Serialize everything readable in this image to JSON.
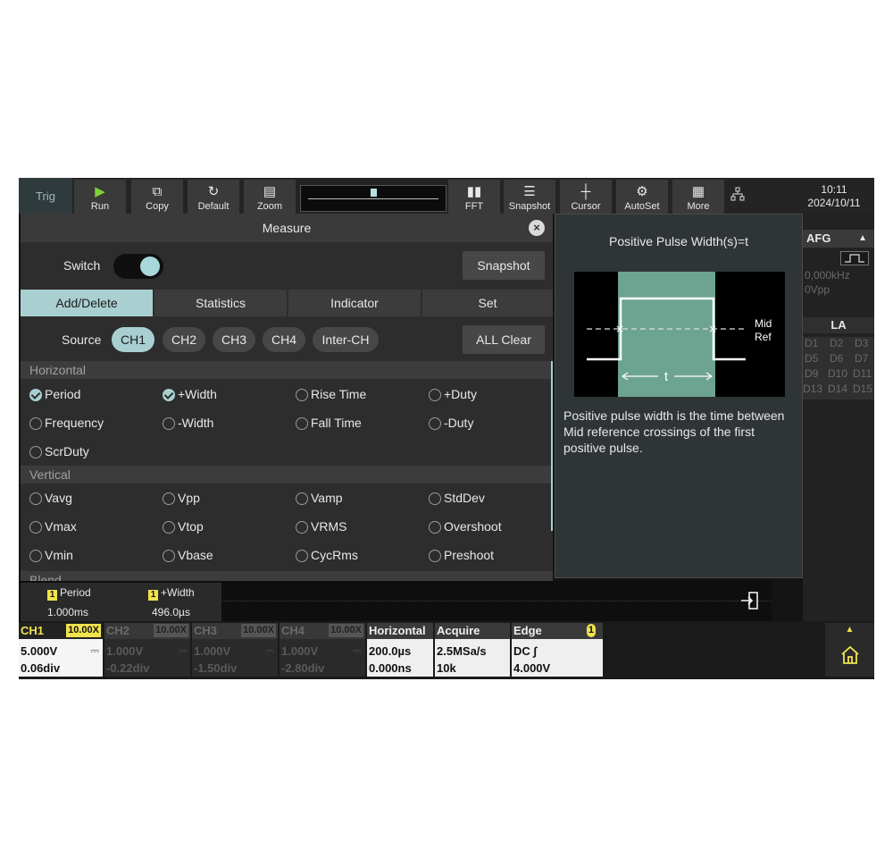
{
  "topbar": {
    "trig": "Trig",
    "buttons": [
      {
        "label": "Run",
        "icon": "▶"
      },
      {
        "label": "Copy",
        "icon": "⧉"
      },
      {
        "label": "Default",
        "icon": "↻"
      },
      {
        "label": "Zoom",
        "icon": "▤"
      },
      {
        "label": "FFT",
        "icon": "▮▮"
      },
      {
        "label": "Snapshot",
        "icon": "☰"
      },
      {
        "label": "Cursor",
        "icon": "┼"
      },
      {
        "label": "AutoSet",
        "icon": "⚙"
      },
      {
        "label": "More",
        "icon": "▦"
      }
    ],
    "time": "10:11",
    "date": "2024/10/11"
  },
  "measure": {
    "title": "Measure",
    "switch_label": "Switch",
    "snapshot_label": "Snapshot",
    "tabs": [
      "Add/Delete",
      "Statistics",
      "Indicator",
      "Set"
    ],
    "source_label": "Source",
    "sources": [
      "CH1",
      "CH2",
      "CH3",
      "CH4",
      "Inter-CH"
    ],
    "all_clear_label": "ALL Clear",
    "sections": {
      "horizontal": "Horizontal",
      "vertical": "Vertical",
      "blend": "Blend"
    },
    "horizontal_items": [
      "Period",
      "+Width",
      "Rise Time",
      "+Duty",
      "Frequency",
      "-Width",
      "Fall Time",
      "-Duty",
      "ScrDuty"
    ],
    "vertical_items": [
      "Vavg",
      "Vpp",
      "Vamp",
      "StdDev",
      "Vmax",
      "Vtop",
      "VRMS",
      "Overshoot",
      "Vmin",
      "Vbase",
      "CycRms",
      "Preshoot"
    ]
  },
  "info": {
    "title": "Positive Pulse Width(s)=t",
    "diagram_mid_label": "Mid",
    "diagram_ref_label": "Ref",
    "diagram_t_label": "t",
    "description": "Positive pulse width is the time between Mid reference crossings of the first positive pulse."
  },
  "afg": {
    "label": "AFG",
    "freq": "0,000kHz",
    "amp": "0Vpp"
  },
  "la": {
    "label": "LA",
    "rows": [
      [
        "D1",
        "D2",
        "D3"
      ],
      [
        "D5",
        "D6",
        "D7"
      ],
      [
        "D9",
        "D10",
        "D11"
      ],
      [
        "D13",
        "D14",
        "D15"
      ]
    ]
  },
  "results": [
    {
      "name": "Period",
      "value": "1.000ms",
      "ch": "1"
    },
    {
      "name": "+Width",
      "value": "496.0µs",
      "ch": "1"
    }
  ],
  "channels": [
    {
      "name": "CH1",
      "probe": "10.00X",
      "v1": "5.000V",
      "v2": "0.06div",
      "dc": "⎓"
    },
    {
      "name": "CH2",
      "probe": "10.00X",
      "v1": "1.000V",
      "v2": "-0.22div",
      "dc": "⎓"
    },
    {
      "name": "CH3",
      "probe": "10.00X",
      "v1": "1.000V",
      "v2": "-1.50div",
      "dc": "⎓"
    },
    {
      "name": "CH4",
      "probe": "10.00X",
      "v1": "1.000V",
      "v2": "-2.80div",
      "dc": "⎓"
    }
  ],
  "horizontal": {
    "label": "Horizontal",
    "v1": "200.0µs",
    "v2": "0.000ns"
  },
  "acquire": {
    "label": "Acquire",
    "v1": "2.5MSa/s",
    "v2": "10k"
  },
  "edge": {
    "label": "Edge",
    "badge": "1",
    "v1": "DC ∫",
    "v2": "4.000V"
  },
  "colors": {
    "accent": "#a9cfd1",
    "ch1": "#f0e34d"
  }
}
